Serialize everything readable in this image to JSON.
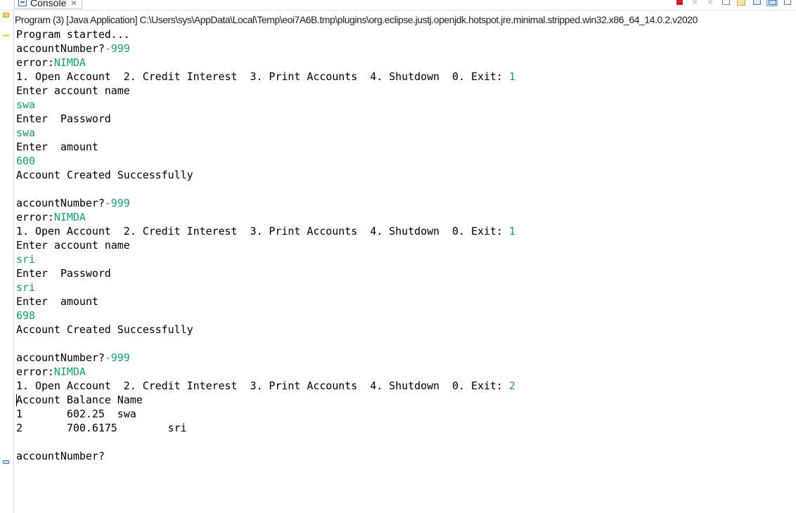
{
  "tab": {
    "title": "Console",
    "close_glyph": "✕",
    "icon": "console-icon"
  },
  "toolbar": {
    "icons": [
      "terminate-icon",
      "remove-launch-icon",
      "remove-all-icon",
      "clear-console-icon",
      "scroll-lock-icon",
      "pin-console-icon",
      "display-selected-console-icon",
      "minimize-icon"
    ]
  },
  "process_header": "Program (3) [Java Application] C:\\Users\\sys\\AppData\\Local\\Temp\\eoi7A6B.tmp\\plugins\\org.eclipse.justj.openjdk.hotspot.jre.minimal.stripped.win32.x86_64_14.0.2.v2020",
  "colors": {
    "stdin": "#0fa36e",
    "stdout": "#000000",
    "terminate": "#d51c1c"
  },
  "console": {
    "lines": [
      {
        "out": "Program started...",
        "in": ""
      },
      {
        "out": "accountNumber?",
        "in": "-999"
      },
      {
        "out": "error:",
        "in": "NIMDA"
      },
      {
        "out": "1. Open Account  2. Credit Interest  3. Print Accounts  4. Shutdown  0. Exit: ",
        "in": "1"
      },
      {
        "out": "Enter account name",
        "in": ""
      },
      {
        "out": "",
        "in": "swa"
      },
      {
        "out": "Enter  Password",
        "in": ""
      },
      {
        "out": "",
        "in": "swa"
      },
      {
        "out": "Enter  amount",
        "in": ""
      },
      {
        "out": "",
        "in": "600"
      },
      {
        "out": "Account Created Successfully",
        "in": ""
      },
      {
        "out": "",
        "in": ""
      },
      {
        "out": "accountNumber?",
        "in": "-999"
      },
      {
        "out": "error:",
        "in": "NIMDA"
      },
      {
        "out": "1. Open Account  2. Credit Interest  3. Print Accounts  4. Shutdown  0. Exit: ",
        "in": "1"
      },
      {
        "out": "Enter account name",
        "in": ""
      },
      {
        "out": "",
        "in": "sri"
      },
      {
        "out": "Enter  Password",
        "in": ""
      },
      {
        "out": "",
        "in": "sri"
      },
      {
        "out": "Enter  amount",
        "in": ""
      },
      {
        "out": "",
        "in": "698"
      },
      {
        "out": "Account Created Successfully",
        "in": ""
      },
      {
        "out": "",
        "in": ""
      },
      {
        "out": "accountNumber?",
        "in": "-999"
      },
      {
        "out": "error:",
        "in": "NIMDA"
      },
      {
        "out": "1. Open Account  2. Credit Interest  3. Print Accounts  4. Shutdown  0. Exit: ",
        "in": "2"
      },
      {
        "out": "Account Balance Name",
        "in": ""
      },
      {
        "out": "1       602.25  swa",
        "in": ""
      },
      {
        "out": "2       700.6175        sri",
        "in": ""
      },
      {
        "out": "",
        "in": ""
      },
      {
        "out": "accountNumber?",
        "in": ""
      }
    ]
  }
}
